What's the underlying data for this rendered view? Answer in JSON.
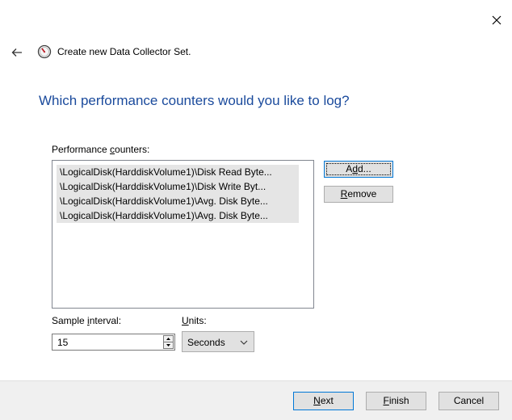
{
  "window": {
    "title": "Create new Data Collector Set.",
    "heading": "Which performance counters would you like to log?"
  },
  "counters": {
    "label_before": "Performance ",
    "label_accel": "c",
    "label_after": "ounters:",
    "items": [
      "\\LogicalDisk(HarddiskVolume1)\\Disk Read Byte...",
      "\\LogicalDisk(HarddiskVolume1)\\Disk Write Byt...",
      "\\LogicalDisk(HarddiskVolume1)\\Avg. Disk Byte...",
      "\\LogicalDisk(HarddiskVolume1)\\Avg. Disk Byte..."
    ]
  },
  "buttons": {
    "add": {
      "before": "A",
      "accel": "d",
      "after": "d..."
    },
    "remove": {
      "before": "",
      "accel": "R",
      "after": "emove"
    },
    "next": {
      "before": "",
      "accel": "N",
      "after": "ext"
    },
    "finish": {
      "before": "",
      "accel": "F",
      "after": "inish"
    },
    "cancel": "Cancel"
  },
  "sample": {
    "label_before": "Sample ",
    "label_accel": "i",
    "label_after": "nterval:",
    "value": "15"
  },
  "units": {
    "label_before": "",
    "label_accel": "U",
    "label_after": "nits:",
    "selected": "Seconds"
  },
  "icons": {
    "close": "close-icon",
    "back": "back-arrow-icon",
    "app": "performance-monitor-icon",
    "spin_up": "spin-up-icon",
    "spin_down": "spin-down-icon",
    "dropdown": "chevron-down-icon"
  },
  "colors": {
    "heading": "#1a4a9c",
    "footer_bg": "#f0f0f0",
    "list_selection": "#e5e5e5",
    "default_button_border": "#0078d7"
  }
}
